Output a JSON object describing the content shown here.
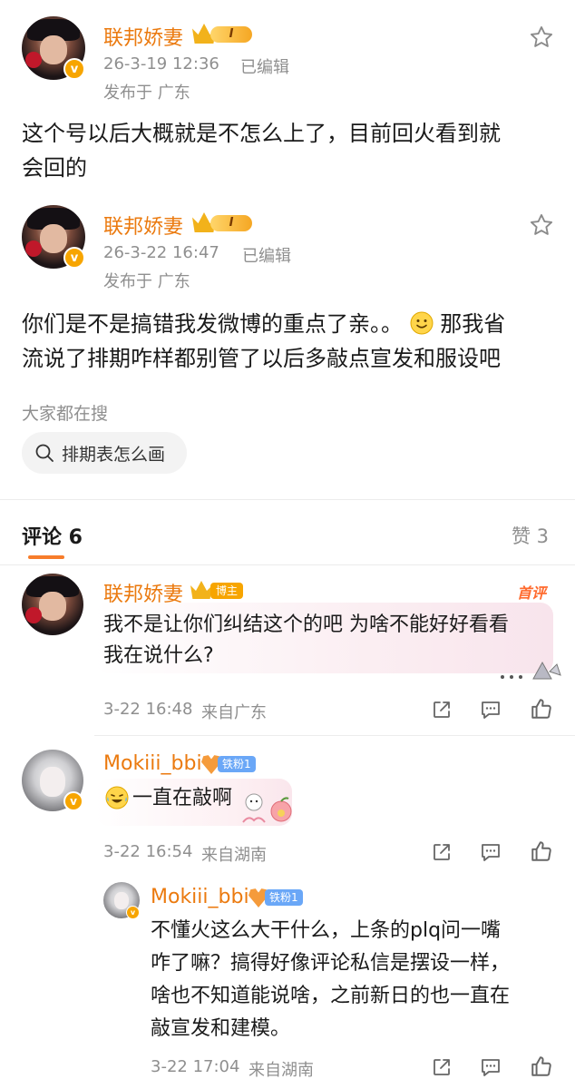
{
  "post1": {
    "author": "联邦娇妻",
    "level": "I",
    "date": "26-3-19 12:36",
    "edited": "已编辑",
    "location": "发布于 广东",
    "text_line1": "这个号以后大概就是不怎么上了，目前回火看到就",
    "text_line2": "会回的"
  },
  "post2": {
    "author": "联邦娇妻",
    "level": "I",
    "date": "26-3-22 16:47",
    "edited": "已编辑",
    "location": "发布于 广东",
    "text_line1a": "你们是不是搞错我发微博的重点了亲。。",
    "text_line1b": "那我省",
    "text_line2": "流说了排期咋样都别管了以后多敲点宣发和服设吧"
  },
  "hot_search": {
    "heading": "大家都在搜",
    "query": "排期表怎么画"
  },
  "tabs": {
    "comments_label": "评论 6",
    "likes_label": "赞 3"
  },
  "comments": [
    {
      "author": "联邦娇妻",
      "badge": "博主",
      "tag": "首评",
      "text_line1": "我不是让你们纠结这个的吧 为啥不能好好看看",
      "text_line2": "我在说什么?",
      "time": "3-22 16:48",
      "source": "来自广东"
    },
    {
      "author": "Mokiii_bbi",
      "badge": "铁粉1",
      "text": "一直在敲啊",
      "time": "3-22 16:54",
      "source": "来自湖南"
    }
  ],
  "reply": {
    "author": "Mokiii_bbi",
    "badge": "铁粉1",
    "line1": "不懂火这么大干什么，上条的plq问一嘴",
    "line2": "咋了嘛？搞得好像评论私信是摆设一样，",
    "line3": "啥也不知道能说啥，之前新日的也一直在",
    "line4": "敲宣发和建模。",
    "time": "3-22 17:04",
    "source": "来自湖南"
  },
  "colors": {
    "name_orange": "#eb7a0f",
    "meta_gray": "#8f8f8f",
    "tab_underline": "#f77c2a"
  }
}
